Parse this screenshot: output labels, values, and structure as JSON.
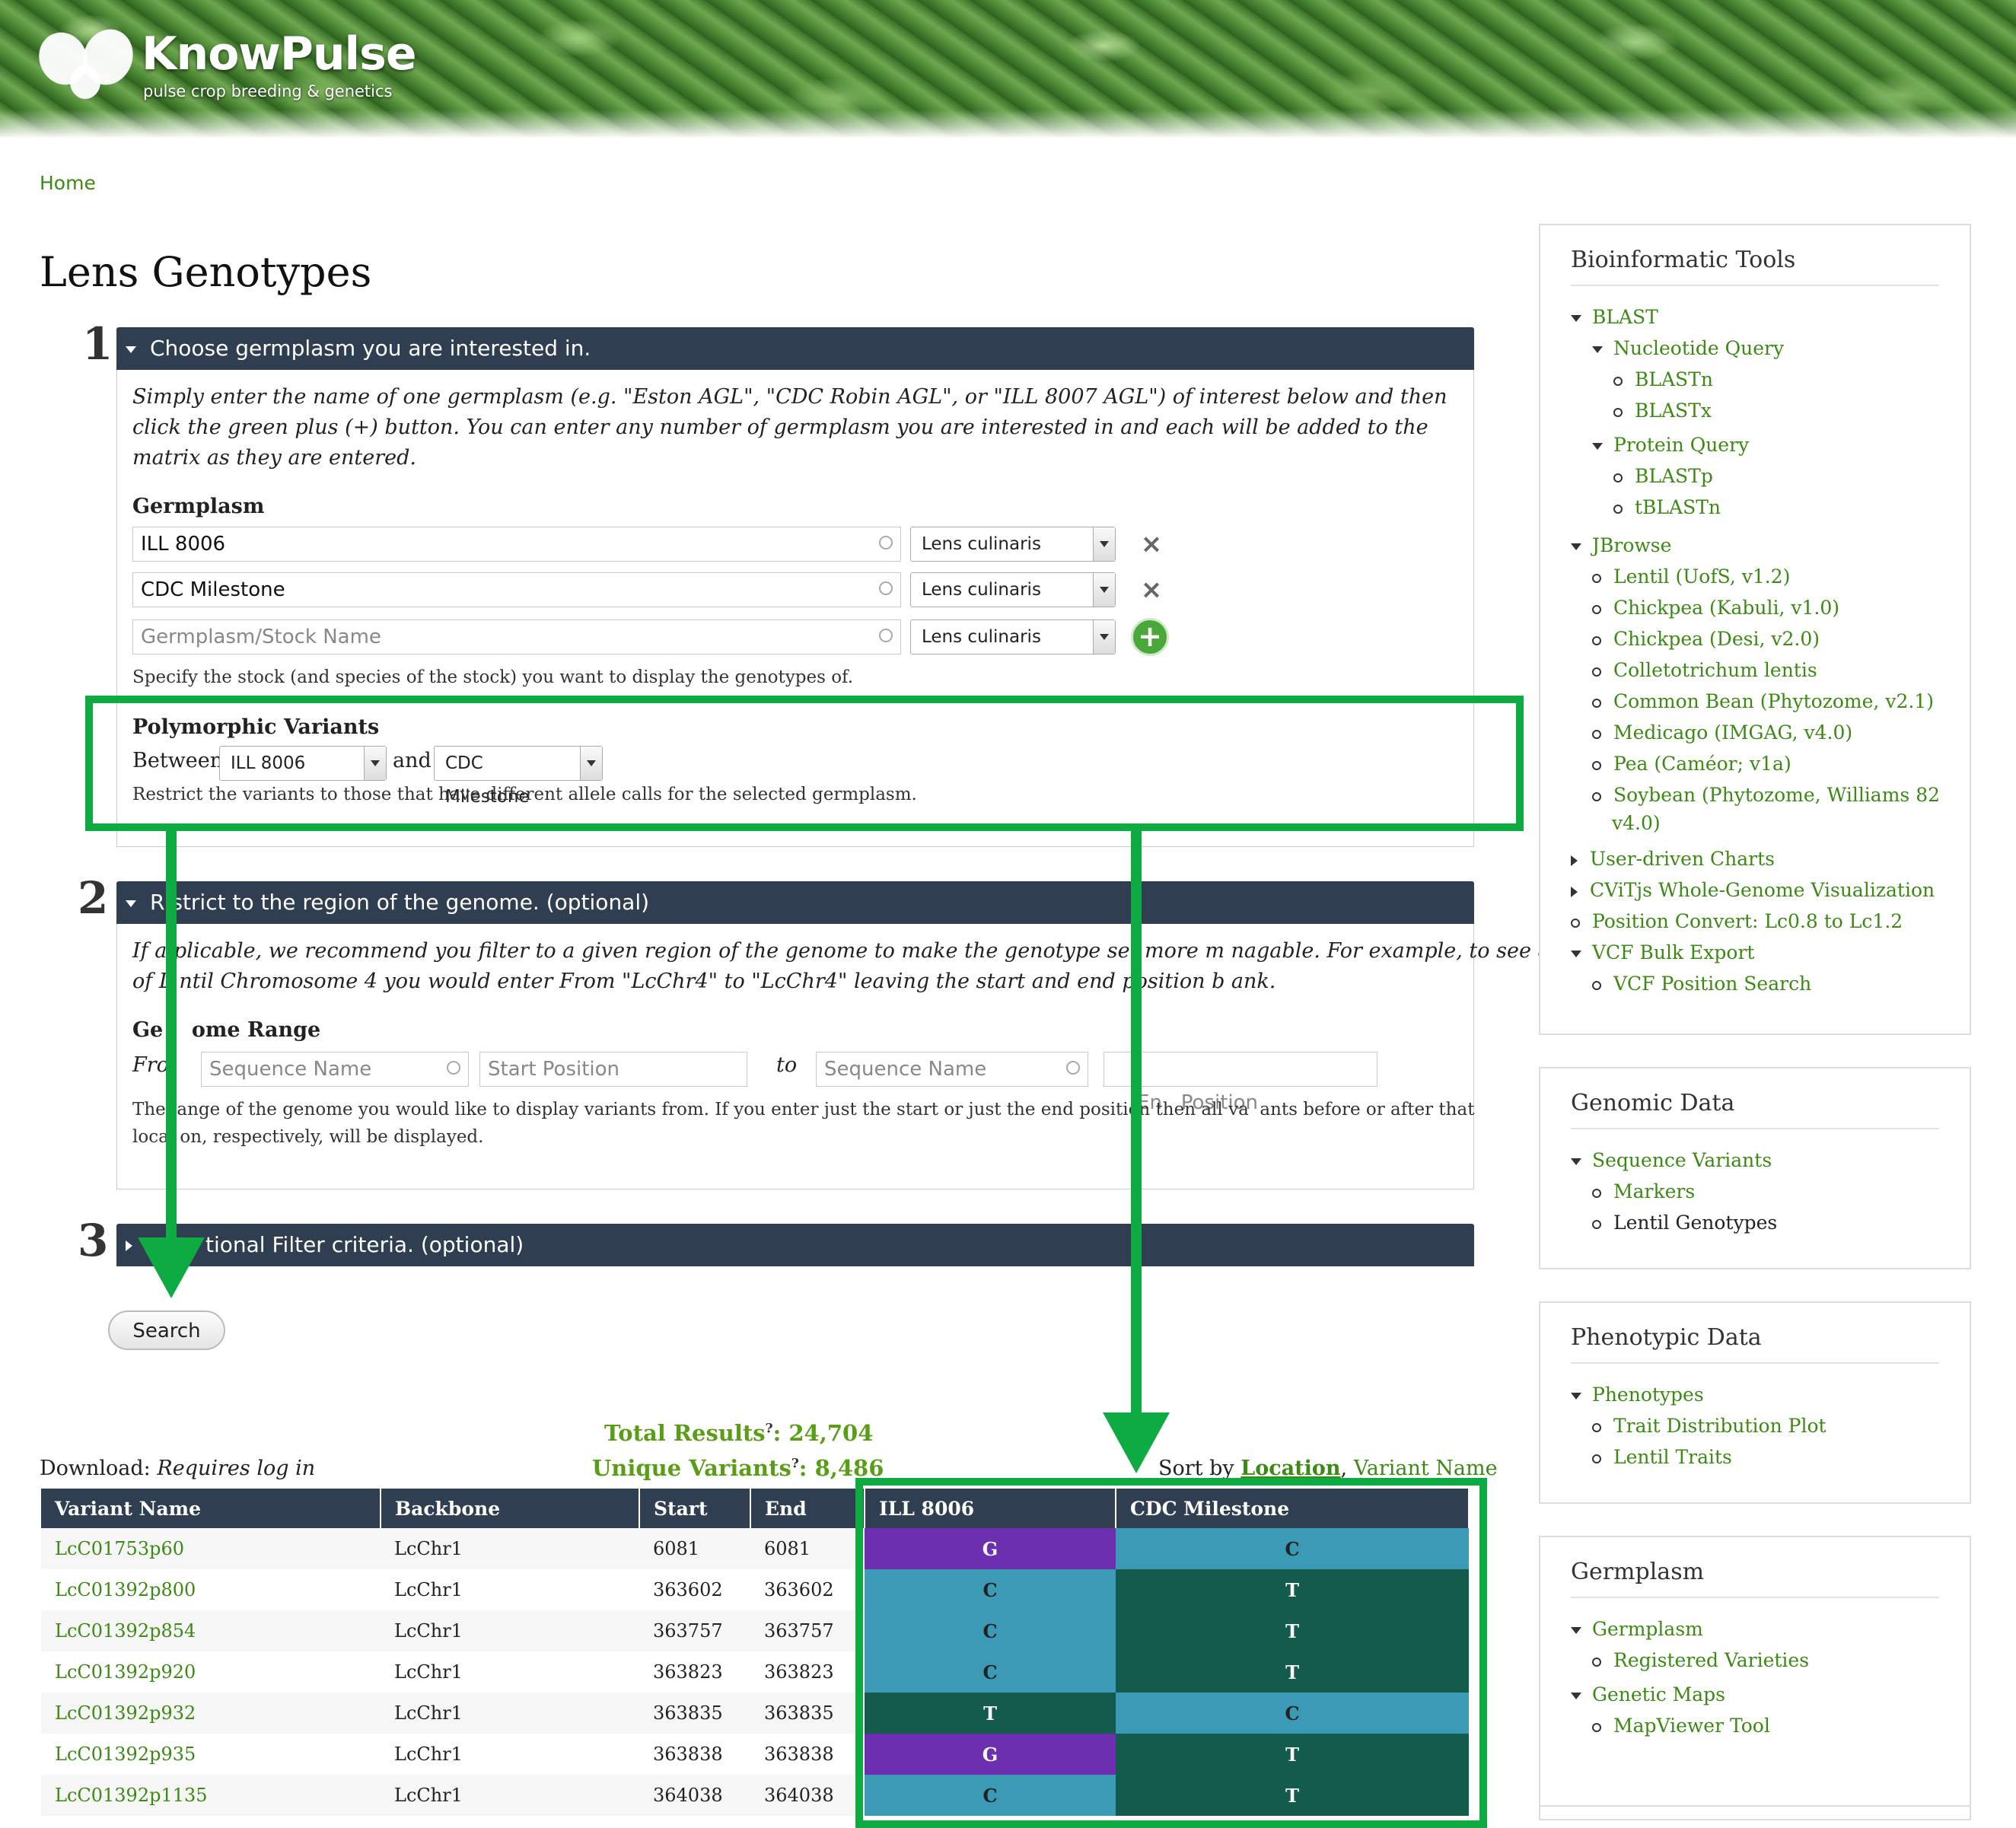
{
  "site": {
    "name": "KnowPulse",
    "tagline": "pulse crop breeding & genetics"
  },
  "breadcrumb": {
    "home": "Home"
  },
  "page_title": "Lens Genotypes",
  "step1": {
    "number": "1",
    "heading": "Choose germplasm you are interested in.",
    "intro": "Simply enter the name of one germplasm (e.g. \"Eston AGL\", \"CDC Robin AGL\", or \"ILL 8007 AGL\") of interest below and then click the green plus (+) button. You can enter any number of germplasm you are interested in and each will be added to the matrix as they are entered.",
    "germplasm_label": "Germplasm",
    "rows": [
      {
        "value": "ILL 8006",
        "species": "Lens culinaris"
      },
      {
        "value": "CDC Milestone",
        "species": "Lens culinaris"
      }
    ],
    "new_row": {
      "placeholder": "Germplasm/Stock Name",
      "species": "Lens culinaris"
    },
    "germplasm_help": "Specify the stock (and species of the stock) you want to display the genotypes of.",
    "poly_label": "Polymorphic Variants",
    "between": "Between",
    "and": "and",
    "poly_a": "ILL 8006",
    "poly_b": "CDC Milestone",
    "poly_help": "Restrict the variants to those that have different allele calls for the selected germplasm."
  },
  "step2": {
    "number": "2",
    "heading": "R  strict to the region of the genome. (optional)",
    "intro_line1": "If a  plicable, we recommend you filter to a given region of the genome to make the genotype set more m  nagable. For example, to see all",
    "intro_line2": "of L  ntil Chromosome 4 you would enter From \"LcChr4\" to \"LcChr4\" leaving the start and end position b  ank.",
    "range_label": "Ge    ome Range",
    "from": "Fro",
    "to": "to",
    "seq_placeholder": "Sequence Name",
    "start_placeholder": "Start Position",
    "end_placeholder": "En   Position",
    "help_line1": "The  ange of the genome you would like to display variants from. If you enter just the start or just the end position then all va  ants before or after that",
    "help_line2": "loca  on, respectively, will be displayed."
  },
  "step3": {
    "number": "3",
    "heading": "tional Filter criteria. (optional)"
  },
  "search_button": "Search",
  "totals": {
    "total_label": "Total Results",
    "total_value": ": 24,704",
    "unique_label": "Unique Variants",
    "unique_value": ": 8,486",
    "q": "?"
  },
  "download": {
    "label": "Download:",
    "note": "Requires log in"
  },
  "sort": {
    "label": "Sort by",
    "primary": "Location",
    "sep": ",",
    "secondary": "Variant Name"
  },
  "table": {
    "headers": [
      "Variant Name",
      "Backbone",
      "Start",
      "End",
      "ILL 8006",
      "CDC Milestone"
    ],
    "rows": [
      [
        "LcC01753p60",
        "LcChr1",
        "6081",
        "6081",
        "G",
        "C"
      ],
      [
        "LcC01392p800",
        "LcChr1",
        "363602",
        "363602",
        "C",
        "T"
      ],
      [
        "LcC01392p854",
        "LcChr1",
        "363757",
        "363757",
        "C",
        "T"
      ],
      [
        "LcC01392p920",
        "LcChr1",
        "363823",
        "363823",
        "C",
        "T"
      ],
      [
        "LcC01392p932",
        "LcChr1",
        "363835",
        "363835",
        "T",
        "C"
      ],
      [
        "LcC01392p935",
        "LcChr1",
        "363838",
        "363838",
        "G",
        "T"
      ],
      [
        "LcC01392p1135",
        "LcChr1",
        "364038",
        "364038",
        "C",
        "T"
      ]
    ]
  },
  "allele_colors": {
    "G": "#6b2fb0",
    "C": "#3b9ab5",
    "T": "#135b4c"
  },
  "highlight_color": "#0dab42",
  "sidebar": {
    "bioinformatic": {
      "title": "Bioinformatic Tools",
      "items": [
        "BLAST",
        "Nucleotide Query",
        "BLASTn",
        "BLASTx",
        "Protein Query",
        "BLASTp",
        "tBLASTn",
        "JBrowse",
        "Lentil (UofS, v1.2)",
        "Chickpea (Kabuli, v1.0)",
        "Chickpea (Desi, v2.0)",
        "Colletotrichum lentis",
        "Common Bean (Phytozome, v2.1)",
        "Medicago (IMGAG, v4.0)",
        "Pea (Caméor; v1a)",
        "Soybean (Phytozome, Williams 82",
        "v4.0)",
        "User-driven Charts",
        "CViTjs Whole-Genome Visualization",
        "Position Convert: Lc0.8 to Lc1.2",
        "VCF Bulk Export",
        "VCF Position Search"
      ]
    },
    "genomic": {
      "title": "Genomic Data",
      "items": [
        "Sequence Variants",
        "Markers",
        "Lentil Genotypes"
      ]
    },
    "phenotypic": {
      "title": "Phenotypic Data",
      "items": [
        "Phenotypes",
        "Trait Distribution Plot",
        "Lentil Traits"
      ]
    },
    "germplasm": {
      "title": "Germplasm",
      "items": [
        "Germplasm",
        "Registered Varieties",
        "Genetic Maps",
        "MapViewer Tool"
      ]
    }
  }
}
